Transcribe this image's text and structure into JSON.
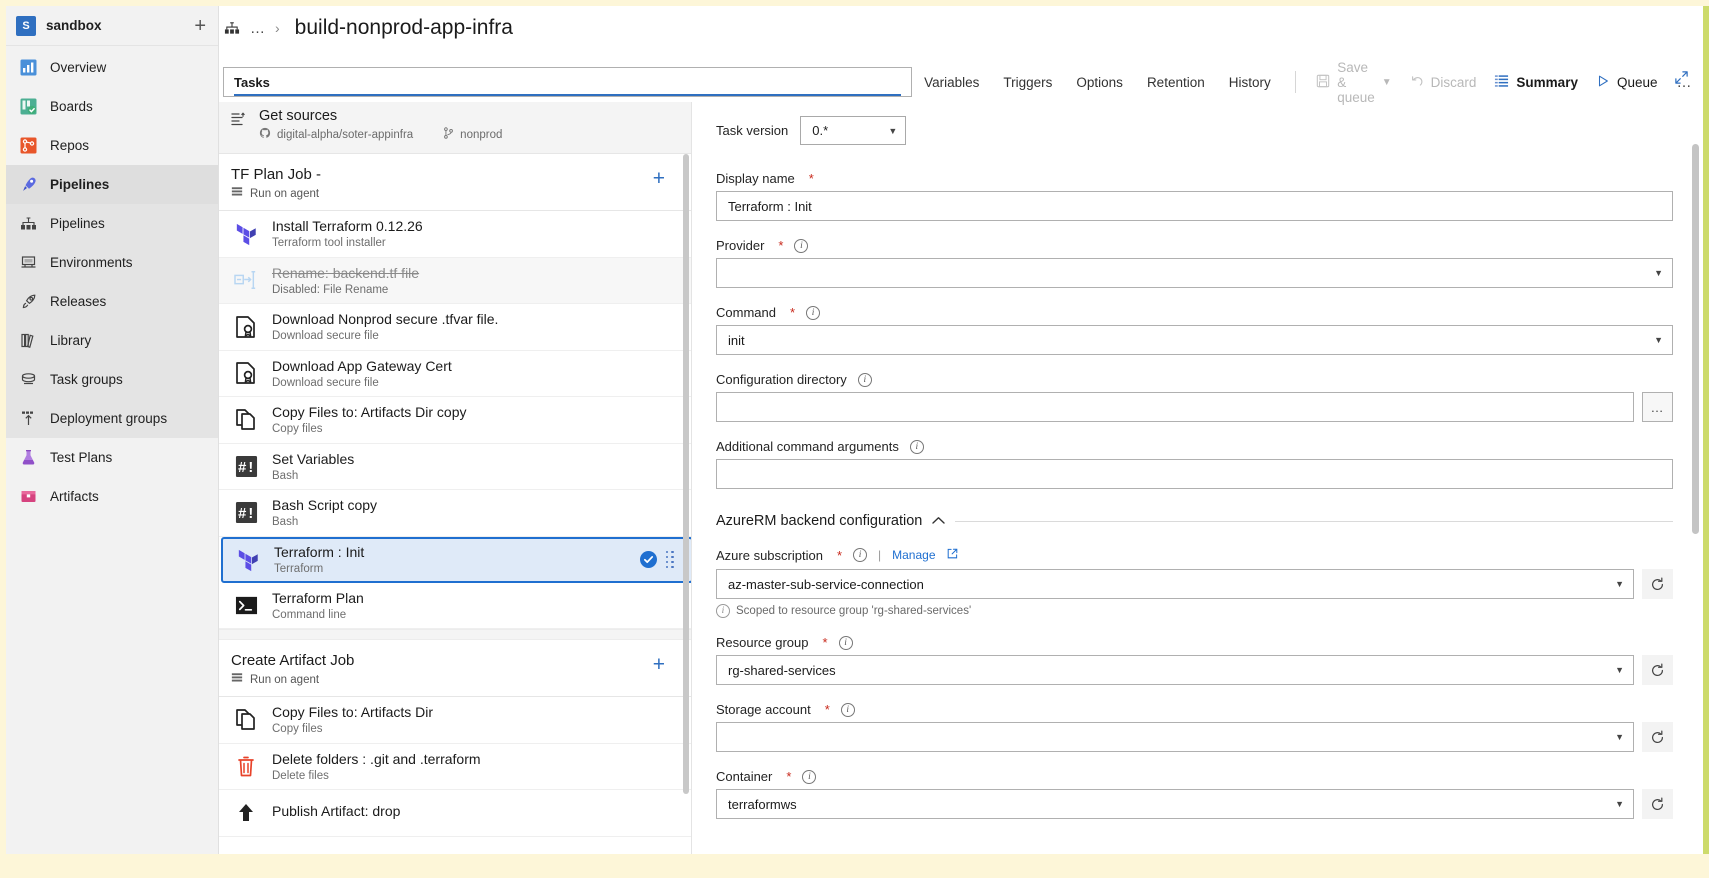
{
  "sidebar": {
    "project": {
      "initial": "S",
      "name": "sandbox",
      "add_label": "+"
    },
    "items": [
      {
        "label": "Overview",
        "icon": "overview-icon"
      },
      {
        "label": "Boards",
        "icon": "boards-icon"
      },
      {
        "label": "Repos",
        "icon": "repos-icon"
      },
      {
        "label": "Pipelines",
        "icon": "pipelines-icon"
      },
      {
        "label": "Pipelines",
        "icon": "pipelines-sub-icon"
      },
      {
        "label": "Environments",
        "icon": "environments-icon"
      },
      {
        "label": "Releases",
        "icon": "releases-icon"
      },
      {
        "label": "Library",
        "icon": "library-icon"
      },
      {
        "label": "Task groups",
        "icon": "task-groups-icon"
      },
      {
        "label": "Deployment groups",
        "icon": "deployment-groups-icon"
      },
      {
        "label": "Test Plans",
        "icon": "test-plans-icon"
      },
      {
        "label": "Artifacts",
        "icon": "artifacts-icon"
      }
    ]
  },
  "header": {
    "breadcrumb_icon": "pipeline-icon",
    "breadcrumb_ellipsis": "…",
    "breadcrumb_separator": "›",
    "title": "build-nonprod-app-infra",
    "expand_icon": "expand-icon"
  },
  "tabs": [
    {
      "label": "Tasks",
      "selected": true
    },
    {
      "label": "Variables",
      "selected": false
    },
    {
      "label": "Triggers",
      "selected": false
    },
    {
      "label": "Options",
      "selected": false
    },
    {
      "label": "Retention",
      "selected": false
    },
    {
      "label": "History",
      "selected": false
    }
  ],
  "toolbar": {
    "save_queue_label": "Save & queue",
    "save_queue_disabled": true,
    "discard_label": "Discard",
    "discard_disabled": true,
    "summary_label": "Summary",
    "queue_label": "Queue",
    "more_label": "…"
  },
  "get_sources": {
    "title": "Get sources",
    "repo": "digital-alpha/soter-appinfra",
    "branch": "nonprod"
  },
  "jobs": [
    {
      "name": "TF Plan Job -",
      "agent": "Run on agent",
      "add_label": "+",
      "tasks": [
        {
          "name": "Install Terraform 0.12.26",
          "sub": "Terraform tool installer",
          "icon": "terraform-icon",
          "state": "normal"
        },
        {
          "name": "Rename: backend.tf file",
          "sub": "Disabled: File Rename",
          "icon": "file-rename-icon",
          "state": "disabled"
        },
        {
          "name": "Download Nonprod secure .tfvar file.",
          "sub": "Download secure file",
          "icon": "secure-file-icon",
          "state": "normal"
        },
        {
          "name": "Download App Gateway Cert",
          "sub": "Download secure file",
          "icon": "secure-file-icon",
          "state": "normal"
        },
        {
          "name": "Copy Files to: Artifacts Dir copy",
          "sub": "Copy files",
          "icon": "copy-files-icon",
          "state": "normal"
        },
        {
          "name": "Set Variables",
          "sub": "Bash",
          "icon": "bash-icon",
          "state": "normal"
        },
        {
          "name": "Bash Script copy",
          "sub": "Bash",
          "icon": "bash-icon",
          "state": "normal"
        },
        {
          "name": "Terraform : Init",
          "sub": "Terraform",
          "icon": "terraform-icon",
          "state": "selected"
        },
        {
          "name": "Terraform Plan",
          "sub": "Command line",
          "icon": "command-line-icon",
          "state": "normal"
        }
      ]
    },
    {
      "name": "Create Artifact Job",
      "agent": "Run on agent",
      "add_label": "+",
      "tasks": [
        {
          "name": "Copy Files to: Artifacts Dir",
          "sub": "Copy files",
          "icon": "copy-files-icon",
          "state": "normal"
        },
        {
          "name": "Delete folders : .git and .terraform",
          "sub": "Delete files",
          "icon": "delete-icon",
          "state": "normal"
        },
        {
          "name": "Publish Artifact: drop",
          "sub": "",
          "icon": "publish-icon",
          "state": "normal"
        }
      ]
    }
  ],
  "form": {
    "task_version_label": "Task version",
    "task_version_value": "0.*",
    "display_name_label": "Display name",
    "display_name_value": "Terraform : Init",
    "provider_label": "Provider",
    "provider_value": "",
    "command_label": "Command",
    "command_value": "init",
    "config_dir_label": "Configuration directory",
    "config_dir_value": "",
    "config_dir_browse": "…",
    "additional_args_label": "Additional command arguments",
    "additional_args_value": "",
    "section_title": "AzureRM backend configuration",
    "azure_subscription_label": "Azure subscription",
    "azure_subscription_value": "az-master-sub-service-connection",
    "manage_label": "Manage",
    "scoped_note": "Scoped to resource group 'rg-shared-services'",
    "resource_group_label": "Resource group",
    "resource_group_value": "rg-shared-services",
    "storage_account_label": "Storage account",
    "storage_account_value": "",
    "container_label": "Container",
    "container_value": "terraformws"
  },
  "colors": {
    "accent": "#2f6fc0",
    "selected_bg": "#dfeaf8",
    "selected_border": "#1f6fd0",
    "required": "#c8291c",
    "link": "#1f6fd0"
  }
}
